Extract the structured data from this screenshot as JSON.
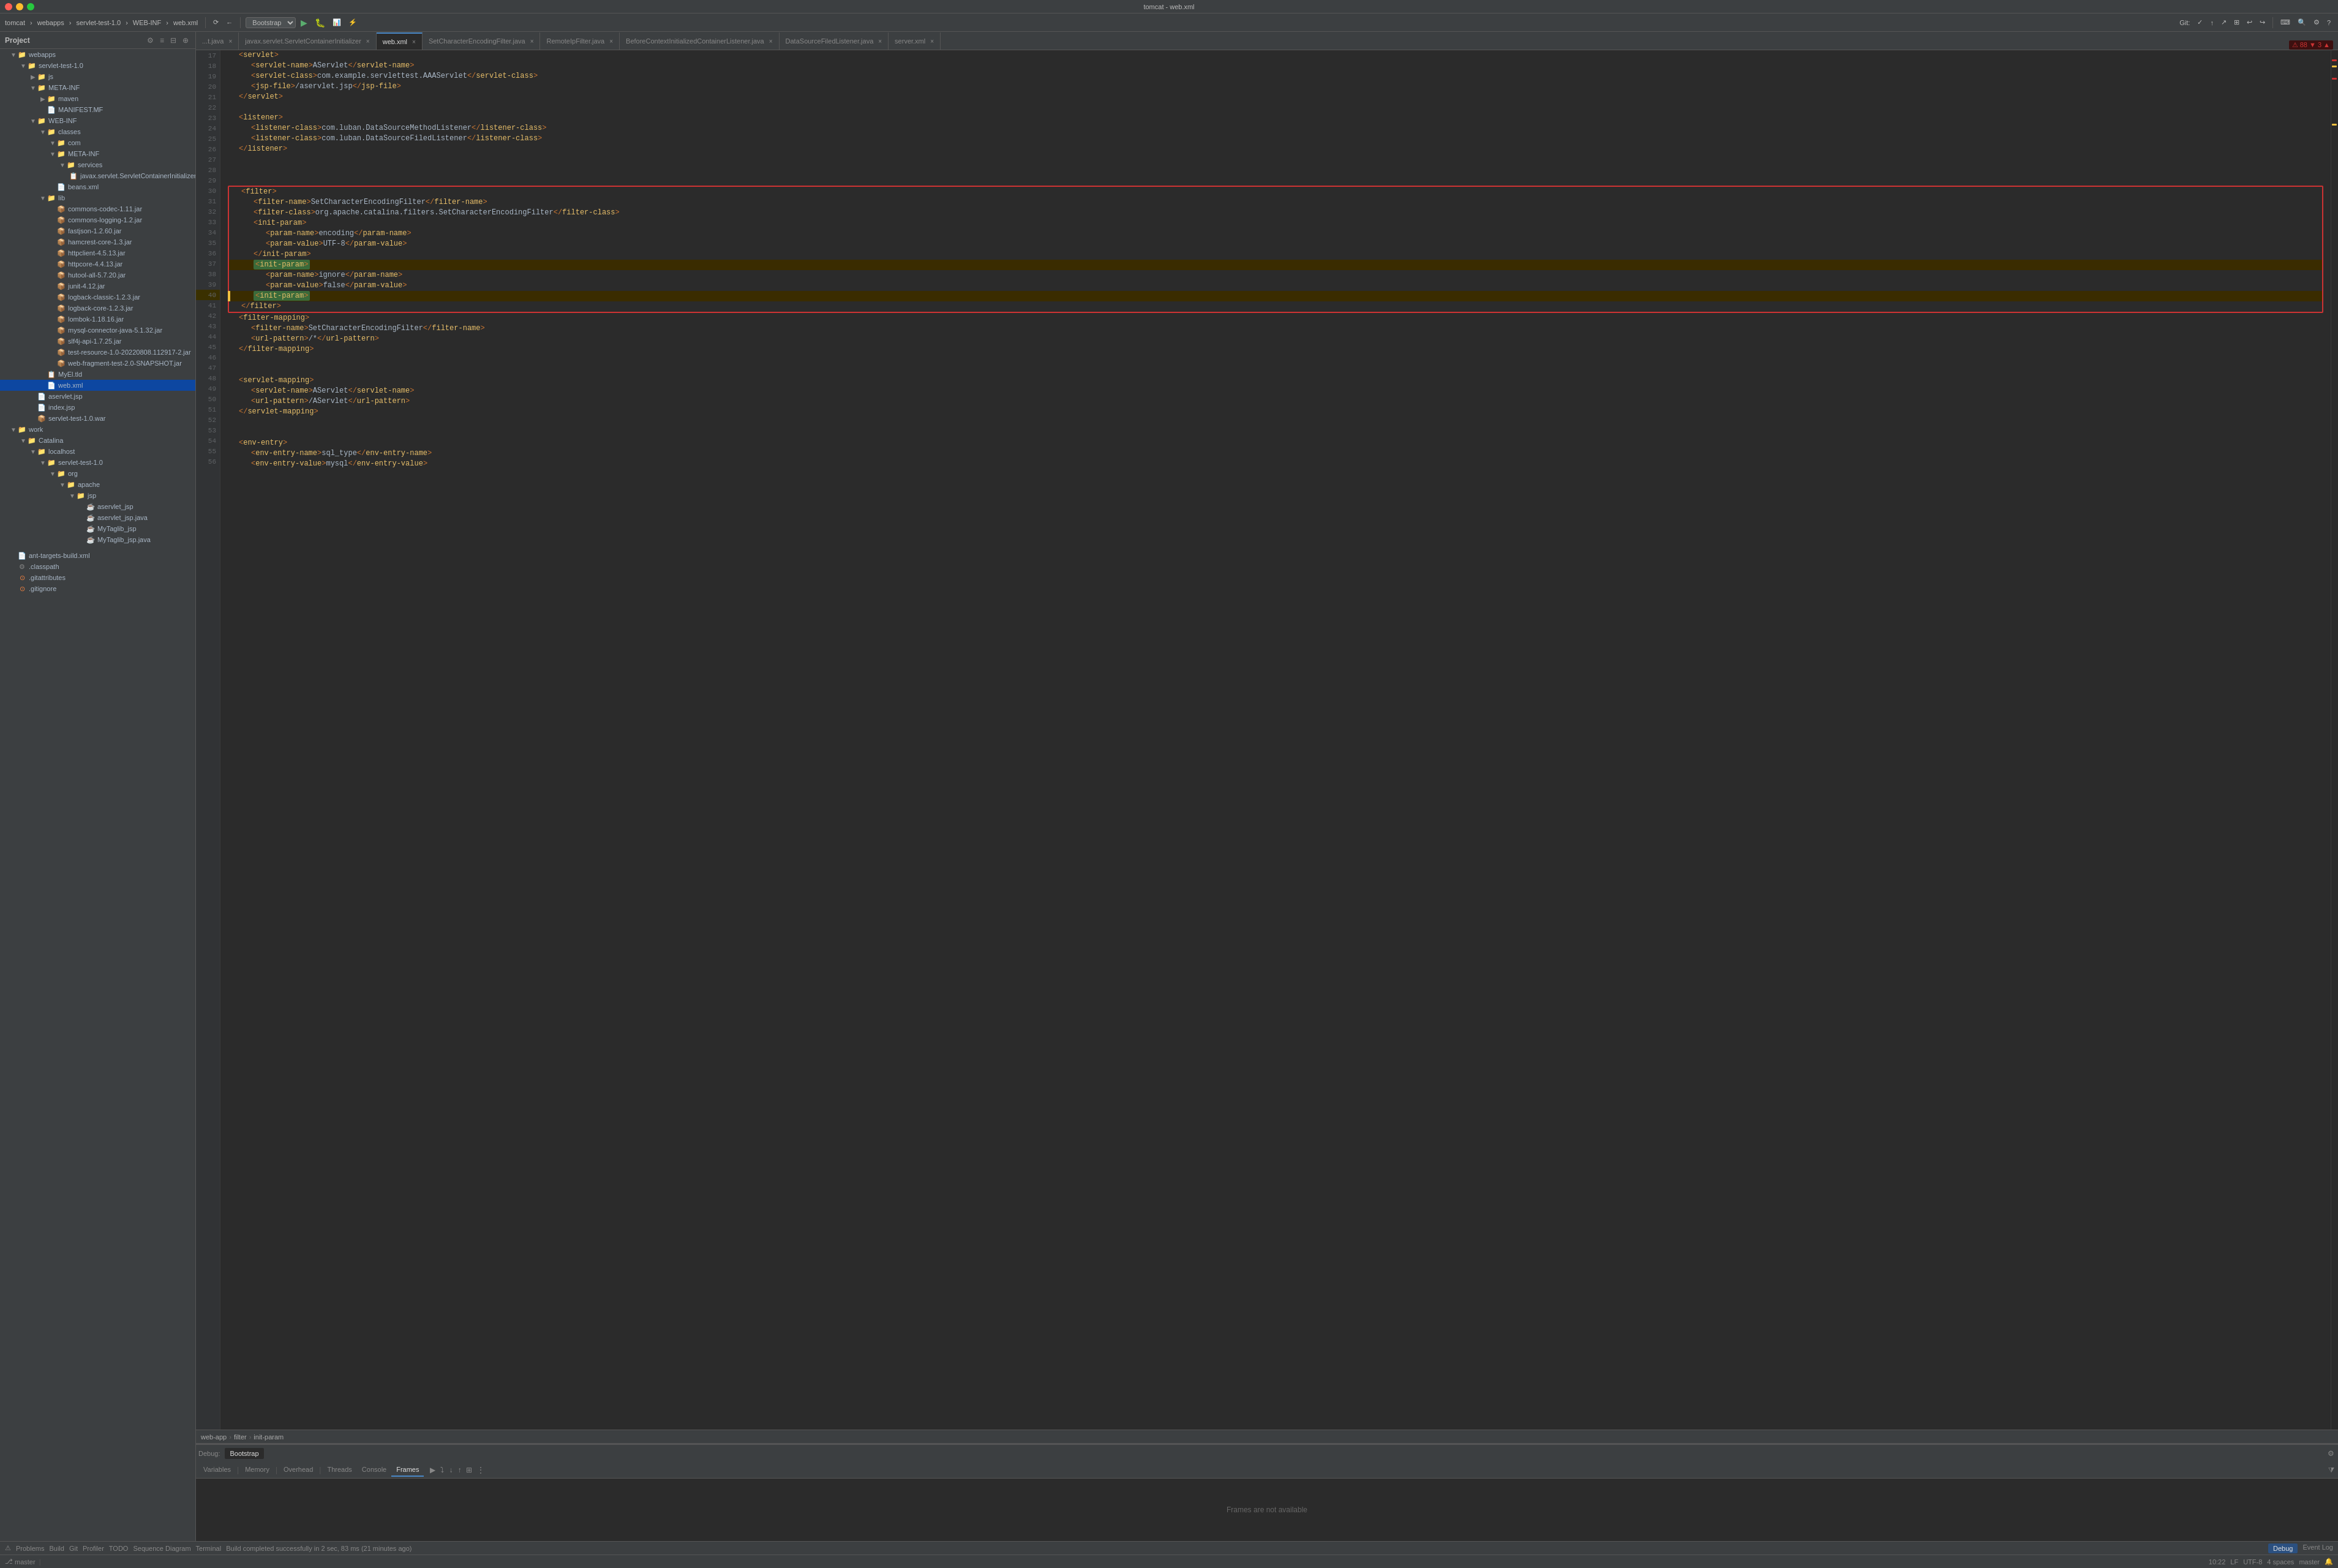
{
  "titleBar": {
    "title": "tomcat - web.xml",
    "trafficLights": [
      "red",
      "yellow",
      "green"
    ]
  },
  "topToolbar": {
    "projectLabel": "tomcat",
    "separator1": ">",
    "webappsLabel": "webapps",
    "separator2": ">",
    "servletLabel": "servlet-test-1.0",
    "separator3": ">",
    "webinfLabel": "WEB-INF",
    "separator4": ">",
    "fileLabel": "web.xml",
    "vcsDropdown": "Bootstrap",
    "gitLabel": "Git:",
    "branchLabel": "master"
  },
  "tabs": [
    {
      "id": "it",
      "label": "...t.java",
      "modified": false,
      "active": false
    },
    {
      "id": "sci",
      "label": "javax.servlet.ServletContainerInitializer",
      "modified": false,
      "active": false
    },
    {
      "id": "webxml",
      "label": "web.xml",
      "modified": false,
      "active": true
    },
    {
      "id": "secf",
      "label": "SetCharacterEncodingFilter.java",
      "modified": false,
      "active": false
    },
    {
      "id": "rip",
      "label": "RemoteIpFilter.java",
      "modified": false,
      "active": false
    },
    {
      "id": "bcicl",
      "label": "BeforeContextInitializedContainerListener.java",
      "modified": false,
      "active": false
    },
    {
      "id": "dsfl",
      "label": "DataSourceFiledListener.java",
      "modified": false,
      "active": false
    },
    {
      "id": "serverxml",
      "label": "server.xml",
      "modified": false,
      "active": false
    }
  ],
  "errorCount": "88",
  "warningCount": "3",
  "sidebar": {
    "title": "Project",
    "tree": [
      {
        "id": "webapps",
        "label": "webapps",
        "type": "folder",
        "depth": 1,
        "expanded": true
      },
      {
        "id": "servlet-test-1.0",
        "label": "servlet-test-1.0",
        "type": "folder",
        "depth": 2,
        "expanded": true
      },
      {
        "id": "js",
        "label": "js",
        "type": "folder",
        "depth": 3,
        "expanded": false
      },
      {
        "id": "META-INF",
        "label": "META-INF",
        "type": "folder",
        "depth": 3,
        "expanded": true
      },
      {
        "id": "maven",
        "label": "maven",
        "type": "folder",
        "depth": 4,
        "expanded": false
      },
      {
        "id": "MANIFEST.MF",
        "label": "MANIFEST.MF",
        "type": "file",
        "depth": 4,
        "fileType": "mf"
      },
      {
        "id": "WEB-INF",
        "label": "WEB-INF",
        "type": "folder",
        "depth": 3,
        "expanded": true
      },
      {
        "id": "classes",
        "label": "classes",
        "type": "folder",
        "depth": 4,
        "expanded": true
      },
      {
        "id": "com",
        "label": "com",
        "type": "folder",
        "depth": 5,
        "expanded": true
      },
      {
        "id": "META-INF2",
        "label": "META-INF",
        "type": "folder",
        "depth": 5,
        "expanded": true
      },
      {
        "id": "services",
        "label": "services",
        "type": "folder",
        "depth": 6,
        "expanded": true
      },
      {
        "id": "javax.servlet.ServletContainerInitializer",
        "label": "javax.servlet.ServletContainerInitializer",
        "type": "file",
        "depth": 7,
        "fileType": "generic"
      },
      {
        "id": "beans.xml",
        "label": "beans.xml",
        "type": "file",
        "depth": 5,
        "fileType": "xml"
      },
      {
        "id": "lib",
        "label": "lib",
        "type": "folder",
        "depth": 4,
        "expanded": true
      },
      {
        "id": "commons-codec",
        "label": "commons-codec-1.11.jar",
        "type": "file",
        "depth": 5,
        "fileType": "jar"
      },
      {
        "id": "commons-logging",
        "label": "commons-logging-1.2.jar",
        "type": "file",
        "depth": 5,
        "fileType": "jar"
      },
      {
        "id": "fastjson",
        "label": "fastjson-1.2.60.jar",
        "type": "file",
        "depth": 5,
        "fileType": "jar"
      },
      {
        "id": "hamcrest",
        "label": "hamcrest-core-1.3.jar",
        "type": "file",
        "depth": 5,
        "fileType": "jar"
      },
      {
        "id": "httpclient",
        "label": "httpclient-4.5.13.jar",
        "type": "file",
        "depth": 5,
        "fileType": "jar"
      },
      {
        "id": "httpcore",
        "label": "httpcore-4.4.13.jar",
        "type": "file",
        "depth": 5,
        "fileType": "jar"
      },
      {
        "id": "hutool",
        "label": "hutool-all-5.7.20.jar",
        "type": "file",
        "depth": 5,
        "fileType": "jar"
      },
      {
        "id": "junit",
        "label": "junit-4.12.jar",
        "type": "file",
        "depth": 5,
        "fileType": "jar"
      },
      {
        "id": "logback-classic",
        "label": "logback-classic-1.2.3.jar",
        "type": "file",
        "depth": 5,
        "fileType": "jar"
      },
      {
        "id": "logback-core",
        "label": "logback-core-1.2.3.jar",
        "type": "file",
        "depth": 5,
        "fileType": "jar"
      },
      {
        "id": "lombok",
        "label": "lombok-1.18.16.jar",
        "type": "file",
        "depth": 5,
        "fileType": "jar"
      },
      {
        "id": "mysql-connector",
        "label": "mysql-connector-java-5.1.32.jar",
        "type": "file",
        "depth": 5,
        "fileType": "jar"
      },
      {
        "id": "slf4j",
        "label": "slf4j-api-1.7.25.jar",
        "type": "file",
        "depth": 5,
        "fileType": "jar"
      },
      {
        "id": "test-resource",
        "label": "test-resource-1.0-20220808.112917-2.jar",
        "type": "file",
        "depth": 5,
        "fileType": "jar"
      },
      {
        "id": "web-fragment",
        "label": "web-fragment-test-2.0-SNAPSHOT.jar",
        "type": "file",
        "depth": 5,
        "fileType": "jar"
      },
      {
        "id": "MyEl.tld",
        "label": "MyEl.tld",
        "type": "file",
        "depth": 4,
        "fileType": "tld"
      },
      {
        "id": "web.xml",
        "label": "web.xml",
        "type": "file",
        "depth": 4,
        "fileType": "xml",
        "selected": true
      },
      {
        "id": "aservlet.jsp",
        "label": "aservlet.jsp",
        "type": "file",
        "depth": 3,
        "fileType": "jsp"
      },
      {
        "id": "index.jsp",
        "label": "index.jsp",
        "type": "file",
        "depth": 3,
        "fileType": "jsp"
      },
      {
        "id": "servlettest-war",
        "label": "servlet-test-1.0.war",
        "type": "file",
        "depth": 3,
        "fileType": "war"
      },
      {
        "id": "work",
        "label": "work",
        "type": "folder",
        "depth": 1,
        "expanded": true
      },
      {
        "id": "Catalina",
        "label": "Catalina",
        "type": "folder",
        "depth": 2,
        "expanded": true
      },
      {
        "id": "localhost",
        "label": "localhost",
        "type": "folder",
        "depth": 3,
        "expanded": true
      },
      {
        "id": "servlettest2",
        "label": "servlet-test-1.0",
        "type": "folder",
        "depth": 4,
        "expanded": true
      },
      {
        "id": "org",
        "label": "org",
        "type": "folder",
        "depth": 5,
        "expanded": true
      },
      {
        "id": "apache",
        "label": "apache",
        "type": "folder",
        "depth": 6,
        "expanded": true
      },
      {
        "id": "jsp",
        "label": "jsp",
        "type": "folder",
        "depth": 7,
        "expanded": true
      },
      {
        "id": "aservlet_jsp",
        "label": "aservlet_jsp",
        "type": "file",
        "depth": 8,
        "fileType": "java"
      },
      {
        "id": "aservlet_jsp.java",
        "label": "aservlet_jsp.java",
        "type": "file",
        "depth": 8,
        "fileType": "java"
      },
      {
        "id": "MyTaglib_jsp",
        "label": "MyTaglib_jsp",
        "type": "file",
        "depth": 8,
        "fileType": "java"
      },
      {
        "id": "MyTaglib_jsp.java",
        "label": "MyTaglib_jsp.java",
        "type": "file",
        "depth": 8,
        "fileType": "java"
      }
    ]
  },
  "bottomSidebar": [
    {
      "label": "ant-targets-build.xml",
      "type": "xml"
    },
    {
      "label": ".classpath",
      "type": "classpath"
    },
    {
      "label": ".gitattributes",
      "type": "git"
    },
    {
      "label": ".gitignore",
      "type": "git"
    }
  ],
  "codeLines": [
    {
      "num": 17,
      "content": "    <servlet>",
      "type": "tag-only"
    },
    {
      "num": 18,
      "content": "        <servlet-name>AServlet</servlet-name>",
      "type": "xml"
    },
    {
      "num": 19,
      "content": "        <servlet-class>com.example.servlettest.AAAServlet</servlet-class>",
      "type": "xml"
    },
    {
      "num": 20,
      "content": "        <jsp-file>/aservlet.jsp</jsp-file>",
      "type": "xml"
    },
    {
      "num": 21,
      "content": "    </servlet>",
      "type": "tag-only"
    },
    {
      "num": 22,
      "content": "",
      "type": "empty"
    },
    {
      "num": 23,
      "content": "    <listener>",
      "type": "tag-only"
    },
    {
      "num": 24,
      "content": "        <listener-class>com.luban.DataSourceMethodListener</listener-class>",
      "type": "xml"
    },
    {
      "num": 25,
      "content": "        <listener-class>com.luban.DataSourceFiledListener</listener-class>",
      "type": "xml"
    },
    {
      "num": 26,
      "content": "    </listener>",
      "type": "tag-only"
    },
    {
      "num": 27,
      "content": "",
      "type": "empty"
    },
    {
      "num": 28,
      "content": "",
      "type": "empty"
    },
    {
      "num": 29,
      "content": "",
      "type": "empty"
    },
    {
      "num": 30,
      "content": "    <filter>",
      "type": "tag-only",
      "boxStart": true
    },
    {
      "num": 31,
      "content": "        <filter-name>SetCharacterEncodingFilter</filter-name>",
      "type": "xml",
      "boxed": true
    },
    {
      "num": 32,
      "content": "        <filter-class>org.apache.catalina.filters.SetCharacterEncodingFilter</filter-class>",
      "type": "xml",
      "boxed": true
    },
    {
      "num": 33,
      "content": "        <init-param>",
      "type": "xml",
      "boxed": true
    },
    {
      "num": 34,
      "content": "            <param-name>encoding</param-name>",
      "type": "xml",
      "boxed": true
    },
    {
      "num": 35,
      "content": "            <param-value>UTF-8</param-value>",
      "type": "xml",
      "boxed": true
    },
    {
      "num": 36,
      "content": "        </init-param>",
      "type": "xml",
      "boxed": true
    },
    {
      "num": 37,
      "content": "        <init-param>",
      "type": "xml",
      "boxed": true,
      "highlighted": true
    },
    {
      "num": 38,
      "content": "            <param-name>ignore</param-name>",
      "type": "xml",
      "boxed": true
    },
    {
      "num": 39,
      "content": "            <param-value>false</param-value>",
      "type": "xml",
      "boxed": true
    },
    {
      "num": 40,
      "content": "        <init-param>",
      "type": "xml",
      "boxed": true,
      "warning": true,
      "highlighted": true
    },
    {
      "num": 41,
      "content": "    </filter>",
      "type": "tag-only",
      "boxEnd": true
    },
    {
      "num": 42,
      "content": "    <filter-mapping>",
      "type": "tag-only"
    },
    {
      "num": 43,
      "content": "        <filter-name>SetCharacterEncodingFilter</filter-name>",
      "type": "xml"
    },
    {
      "num": 44,
      "content": "        <url-pattern>/*</url-pattern>",
      "type": "xml"
    },
    {
      "num": 45,
      "content": "    </filter-mapping>",
      "type": "tag-only"
    },
    {
      "num": 46,
      "content": "",
      "type": "empty"
    },
    {
      "num": 47,
      "content": "",
      "type": "empty"
    },
    {
      "num": 48,
      "content": "    <servlet-mapping>",
      "type": "tag-only"
    },
    {
      "num": 49,
      "content": "        <servlet-name>AServlet</servlet-name>",
      "type": "xml"
    },
    {
      "num": 50,
      "content": "        <url-pattern>/AServlet</url-pattern>",
      "type": "xml"
    },
    {
      "num": 51,
      "content": "    </servlet-mapping>",
      "type": "tag-only"
    },
    {
      "num": 52,
      "content": "",
      "type": "empty"
    },
    {
      "num": 53,
      "content": "",
      "type": "empty"
    },
    {
      "num": 54,
      "content": "    <env-entry>",
      "type": "tag-only"
    },
    {
      "num": 55,
      "content": "        <env-entry-name>sql_type</env-entry-name>",
      "type": "xml"
    },
    {
      "num": 56,
      "content": "        <env-entry-value>mysql</env-entry-value>",
      "type": "xml"
    }
  ],
  "breadcrumb": {
    "items": [
      "web-app",
      "filter",
      "init-param"
    ]
  },
  "debugPanel": {
    "title": "Debug",
    "configuration": "Bootstrap",
    "tabs": [
      {
        "id": "variables",
        "label": "Variables"
      },
      {
        "id": "memory",
        "label": "Memory"
      },
      {
        "id": "overhead",
        "label": "Overhead"
      },
      {
        "id": "threads",
        "label": "Threads"
      },
      {
        "id": "console",
        "label": "Console"
      },
      {
        "id": "frames",
        "label": "Frames",
        "active": true
      }
    ],
    "framesMessage": "Frames are not available",
    "filterPlaceholder": "⋮"
  },
  "statusBar": {
    "problems": {
      "label": "Problems",
      "icon": "⚠"
    },
    "build": {
      "label": "Build"
    },
    "git": {
      "label": "Git"
    },
    "profiler": {
      "label": "Profiler"
    },
    "todo": {
      "label": "TODO"
    },
    "sequenceDiagram": {
      "label": "Sequence Diagram"
    },
    "terminal": {
      "label": "Terminal"
    },
    "debug": {
      "label": "Debug",
      "active": true
    },
    "eventLog": {
      "label": "Event Log"
    },
    "rightInfo": "10:22  LF  UTF-8  4 spaces  master  🔔",
    "lineCol": "10:22",
    "encoding": "LF",
    "charset": "UTF-8",
    "indent": "4 spaces",
    "branch": "master"
  },
  "buildStatus": {
    "text": "Build completed successfully in 2 sec, 83 ms (21 minutes ago)"
  }
}
